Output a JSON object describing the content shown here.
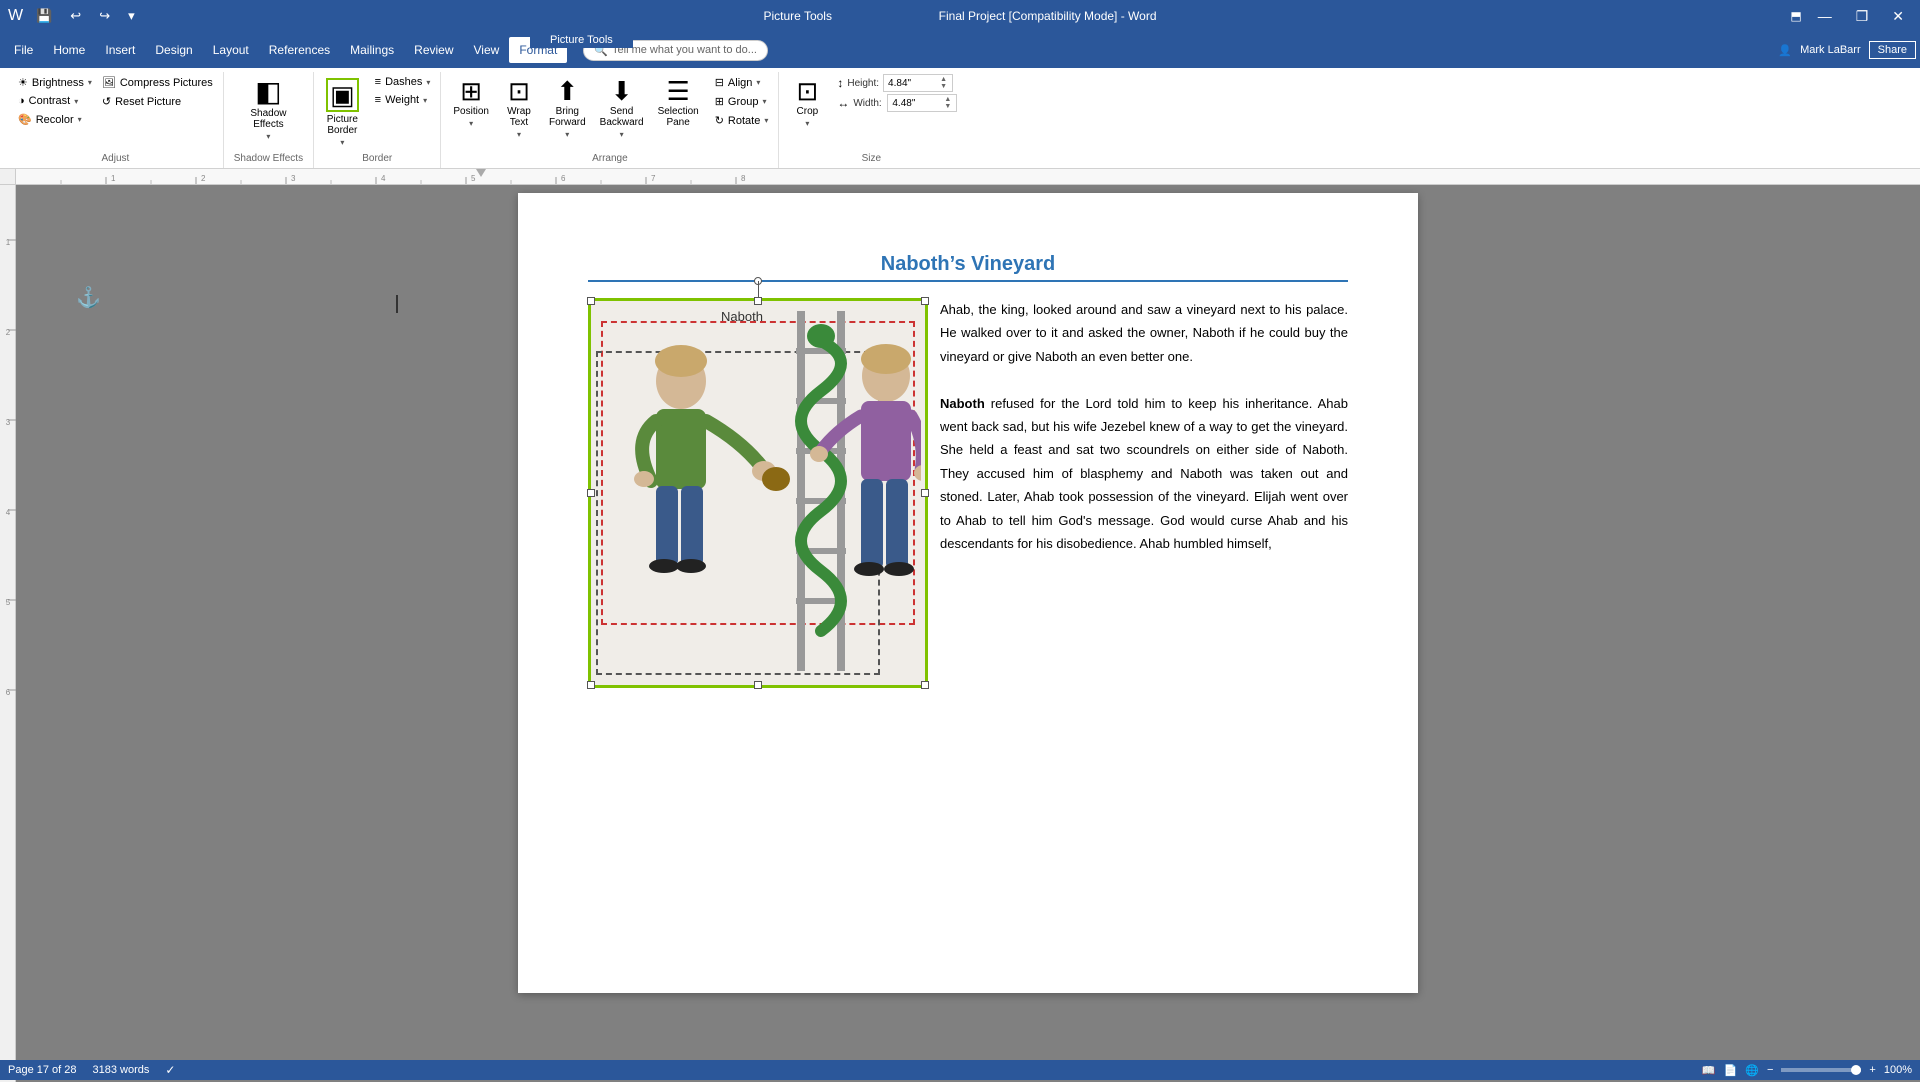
{
  "titlebar": {
    "app_name": "Word",
    "doc_title": "Final Project [Compatibility Mode] - Word",
    "context_tool": "Picture Tools",
    "qat_buttons": [
      "save",
      "undo",
      "redo",
      "customize"
    ],
    "window_buttons": [
      "minimize",
      "restore",
      "close"
    ],
    "user": "Mark LaBarr",
    "share": "Share"
  },
  "menu": {
    "items": [
      "File",
      "Home",
      "Insert",
      "Design",
      "Layout",
      "References",
      "Mailings",
      "Review",
      "View",
      "Format"
    ],
    "active": "Format"
  },
  "ribbon": {
    "groups": [
      {
        "name": "Adjust",
        "buttons": [
          {
            "label": "Brightness",
            "type": "small-dropdown"
          },
          {
            "label": "Contrast",
            "type": "small-dropdown"
          },
          {
            "label": "Recolor",
            "type": "small-dropdown"
          },
          {
            "label": "Compress Pictures",
            "type": "small"
          },
          {
            "label": "Reset Picture",
            "type": "small"
          }
        ]
      },
      {
        "name": "Shadow Effects",
        "buttons": [
          {
            "label": "Shadow Effects",
            "type": "large-dropdown"
          }
        ]
      },
      {
        "name": "Border",
        "buttons": [
          {
            "label": "Picture Border",
            "type": "large-dropdown"
          },
          {
            "label": "Dashes",
            "type": "small-dropdown"
          },
          {
            "label": "Weight",
            "type": "small-dropdown"
          }
        ]
      },
      {
        "name": "Arrange",
        "buttons": [
          {
            "label": "Position",
            "type": "large-dropdown"
          },
          {
            "label": "Wrap Text",
            "type": "large-dropdown"
          },
          {
            "label": "Bring Forward",
            "type": "large-dropdown"
          },
          {
            "label": "Send Backward",
            "type": "large-dropdown"
          },
          {
            "label": "Selection Pane",
            "type": "large"
          },
          {
            "label": "Align",
            "type": "small-dropdown"
          },
          {
            "label": "Group",
            "type": "small-dropdown"
          },
          {
            "label": "Rotate",
            "type": "small-dropdown"
          }
        ]
      },
      {
        "name": "Size",
        "buttons": [
          {
            "label": "Crop",
            "type": "large-dropdown"
          }
        ],
        "size_inputs": {
          "height_label": "Height:",
          "height_value": "4.84\"",
          "width_label": "Width:",
          "width_value": "4.48\""
        }
      }
    ],
    "tell_me": "Tell me what you want to do..."
  },
  "document": {
    "title": "Naboth’s Vineyard",
    "paragraphs": [
      "Ahab, the king, looked around and saw a vineyard next to his palace. He walked over to it and asked the owner, Naboth if he could buy the vineyard or give Naboth an even better one.",
      "Naboth refused for the Lord told him to keep his inheritance. Ahab went back sad, but his wife Jezebel knew of a way to get the vineyard. She held a feast and sat two scoundrels on either side of Naboth. They accused him of blasphemy and Naboth was taken out and stoned. Later, Ahab took possession of the vineyard. Elijah went over to Ahab to tell him God’s message. God would curse Ahab and his descendants for his disobedience. Ahab humbled himself,"
    ],
    "image_caption": "Naboth",
    "page_info": "Page 17 of 28",
    "word_count": "3183 words",
    "zoom": "100%"
  },
  "status": {
    "page": "Page 17 of 28",
    "words": "3183 words",
    "language": "",
    "zoom": "100%",
    "view_icons": [
      "read",
      "print",
      "web"
    ]
  },
  "icons": {
    "save": "💾",
    "undo": "↩",
    "redo": "↪",
    "brightness": "☀",
    "shadow": "◧",
    "picture_border": "▣",
    "position": "⊞",
    "wrap_text": "⊡",
    "bring_forward": "⬆",
    "send_backward": "⬇",
    "selection_pane": "☰",
    "align": "≡",
    "group": "⊞",
    "rotate": "↻",
    "crop": "⊡",
    "search": "🔍",
    "anchor": "⚓",
    "cursor": "|"
  }
}
